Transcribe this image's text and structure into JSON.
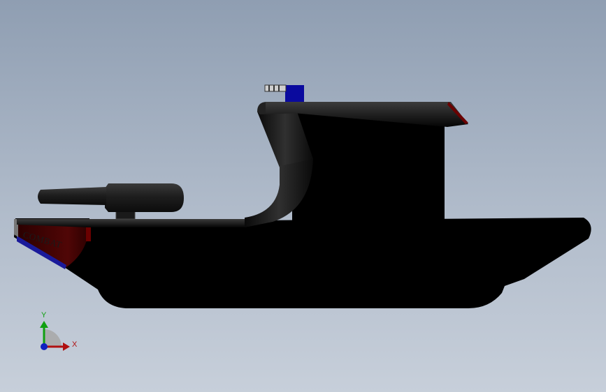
{
  "model": {
    "hull_text": "COMBAT"
  },
  "triad": {
    "y_label": "Y",
    "x_label": "X"
  },
  "colors": {
    "body": "#000000",
    "bow_red": "#3a0000",
    "stripe_blue": "#1a1a9a",
    "beacon_blue": "#0a0a9e",
    "axis_x": "#b01010",
    "axis_y": "#10a010",
    "axis_z": "#1020c0"
  }
}
